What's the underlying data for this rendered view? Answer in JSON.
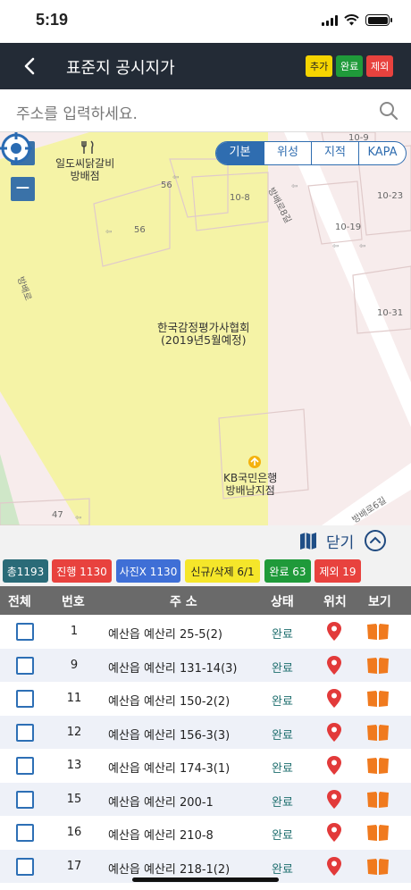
{
  "status_bar": {
    "time": "5:19"
  },
  "header": {
    "title": "표준지 공시지가",
    "buttons": [
      {
        "label": "추가",
        "bg": "#f5d400",
        "fg": "#222"
      },
      {
        "label": "완료",
        "bg": "#1f9a3a",
        "fg": "#fff"
      },
      {
        "label": "제외",
        "bg": "#e8423e",
        "fg": "#fff"
      }
    ]
  },
  "search": {
    "placeholder": "주소를 입력하세요."
  },
  "map": {
    "zoom_in": "+",
    "zoom_out": "−",
    "tabs": [
      "기본",
      "위성",
      "지적",
      "KAPA"
    ],
    "selected_tab": "기본",
    "labels": {
      "restaurant": "일도씨닭갈비\n방배점",
      "main_building": "한국감정평가사협회\n(2019년5월예정)",
      "bank": "KB국민은행\n방배남지점",
      "road_main": "방배로",
      "road_side": "방배로8길",
      "road_bottom": "방배로6길",
      "lot_56a": "56",
      "lot_56b": "56",
      "lot_10_8": "10-8",
      "lot_10_9": "10-9",
      "lot_10_19": "10-19",
      "lot_10_23": "10-23",
      "lot_10_31": "10-31",
      "lot_47": "47"
    }
  },
  "panel": {
    "close_label": "닫기"
  },
  "filters": [
    {
      "label": "총1193",
      "bg": "#2a6b78"
    },
    {
      "label": "진행 1130",
      "bg": "#e8423e"
    },
    {
      "label": "사진X 1130",
      "bg": "#3f6fd6"
    },
    {
      "label": "신규/삭제 6/1",
      "bg": "#f5e62a",
      "fg": "#222"
    },
    {
      "label": "완료 63",
      "bg": "#1f9a3a"
    },
    {
      "label": "제외 19",
      "bg": "#e8423e"
    }
  ],
  "table": {
    "headers": [
      "전체",
      "번호",
      "주 소",
      "상태",
      "위치",
      "보기"
    ],
    "rows": [
      {
        "num": "1",
        "addr": "예산읍 예산리 25-5(2)",
        "status": "완료"
      },
      {
        "num": "9",
        "addr": "예산읍 예산리 131-14(3)",
        "status": "완료"
      },
      {
        "num": "11",
        "addr": "예산읍 예산리 150-2(2)",
        "status": "완료"
      },
      {
        "num": "12",
        "addr": "예산읍 예산리 156-3(3)",
        "status": "완료"
      },
      {
        "num": "13",
        "addr": "예산읍 예산리 174-3(1)",
        "status": "완료"
      },
      {
        "num": "15",
        "addr": "예산읍 예산리 200-1",
        "status": "완료"
      },
      {
        "num": "16",
        "addr": "예산읍 예산리 210-8",
        "status": "완료"
      },
      {
        "num": "17",
        "addr": "예산읍 예산리 218-1(2)",
        "status": "완료"
      }
    ]
  }
}
